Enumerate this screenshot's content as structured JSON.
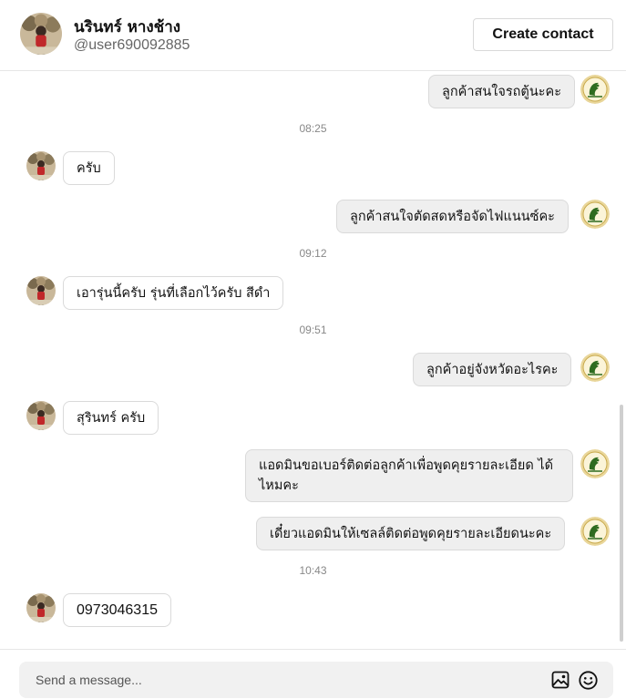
{
  "contact": {
    "name": "นรินทร์ หางช้าง",
    "handle": "@user690092885"
  },
  "actions": {
    "create_contact": "Create contact"
  },
  "messages": [
    {
      "side": "out",
      "text": "ลูกค้าสนใจรถตู้นะคะ"
    },
    {
      "type": "time",
      "text": "08:25"
    },
    {
      "side": "in",
      "text": "ครับ"
    },
    {
      "side": "out",
      "text": "ลูกค้าสนใจตัดสดหรือจัดไฟแนนซ์คะ"
    },
    {
      "type": "time",
      "text": "09:12"
    },
    {
      "side": "in",
      "text": "เอารุ่นนี้ครับ รุ่นที่เลือกไว้ครับ สีดำ"
    },
    {
      "type": "time",
      "text": "09:51"
    },
    {
      "side": "out",
      "text": "ลูกค้าอยู่จังหวัดอะไรคะ"
    },
    {
      "side": "in",
      "text": "สุรินทร์ ครับ"
    },
    {
      "side": "out",
      "text": "แอดมินขอเบอร์ติดต่อลูกค้าเพื่อพูดคุยรายละเอียด ได้ไหมคะ"
    },
    {
      "side": "out",
      "text": "เดี๋ยวแอดมินให้เซลล์ติดต่อพูดคุยรายละเอียดนะคะ"
    },
    {
      "type": "time",
      "text": "10:43"
    },
    {
      "side": "in",
      "text": "0973046315"
    }
  ],
  "composer": {
    "placeholder": "Send a message..."
  },
  "icons": {
    "attach": "image-icon",
    "emoji": "emoji-icon"
  },
  "colors": {
    "out_bubble": "#efefef",
    "brand_badge": "#2e6b1f"
  }
}
